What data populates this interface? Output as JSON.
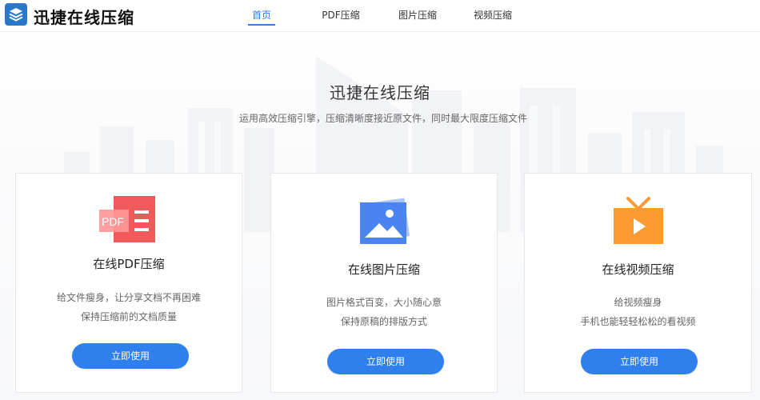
{
  "header": {
    "brand": "迅捷在线压缩",
    "nav": [
      {
        "label": "首页",
        "active": true
      },
      {
        "label": "PDF压缩",
        "active": false
      },
      {
        "label": "图片压缩",
        "active": false
      },
      {
        "label": "视频压缩",
        "active": false
      }
    ]
  },
  "hero": {
    "title": "迅捷在线压缩",
    "subtitle": "运用高效压缩引擎，压缩清晰度接近原文件，同时最大限度压缩文件"
  },
  "cards": [
    {
      "key": "pdf",
      "title": "在线PDF压缩",
      "desc_line1": "给文件瘦身，让分享文档不再困难",
      "desc_line2": "保持压缩前的文档质量",
      "button": "立即使用",
      "icon": "pdf-file-icon",
      "icon_text": "PDF"
    },
    {
      "key": "image",
      "title": "在线图片压缩",
      "desc_line1": "图片格式百变，大小随心意",
      "desc_line2": "保持原稿的排版方式",
      "button": "立即使用",
      "icon": "image-icon"
    },
    {
      "key": "video",
      "title": "在线视频压缩",
      "desc_line1": "给视频瘦身",
      "desc_line2": "手机也能轻轻松松的看视频",
      "button": "立即使用",
      "icon": "video-tv-icon"
    }
  ],
  "colors": {
    "accent": "#2f7de6",
    "button": "#2f80ed",
    "pdf_icon": "#f05a5a",
    "image_icon": "#3f7ff0",
    "video_icon": "#ff9a33",
    "logo": "#2a79c8"
  }
}
